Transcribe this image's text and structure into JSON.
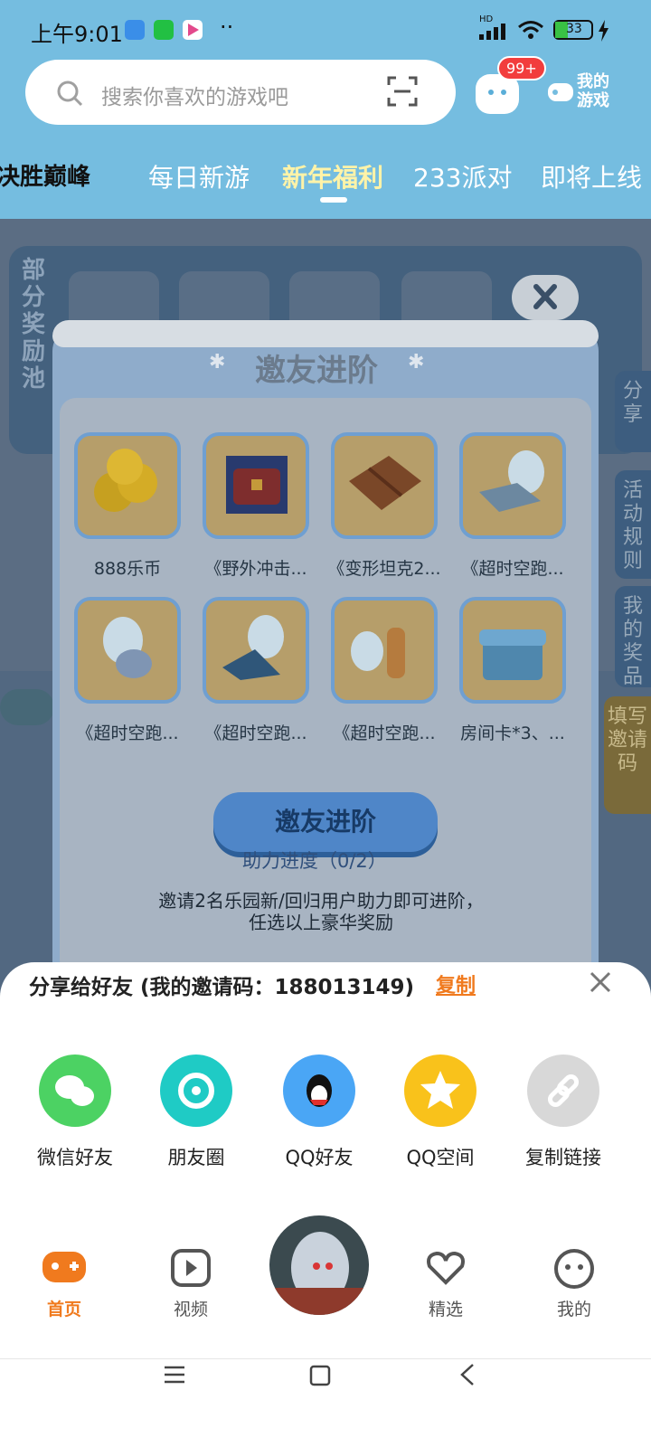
{
  "status_bar": {
    "time": "上午9:01",
    "dots": "··",
    "network": "HD",
    "battery": "33"
  },
  "search": {
    "placeholder": "搜索你喜欢的游戏吧",
    "message_badge": "99+",
    "my_games": "我的\n游戏"
  },
  "tabs": [
    {
      "label": "决胜巅峰"
    },
    {
      "label": "每日新游"
    },
    {
      "label": "新年福利",
      "active": true
    },
    {
      "label": "233派对"
    },
    {
      "label": "即将上线"
    }
  ],
  "background": {
    "reward_pool": "部分奖励池"
  },
  "side_tabs": [
    "分享",
    "活动规则",
    "我的奖品",
    "填写邀请码"
  ],
  "modal": {
    "title": "邀友进阶",
    "rewards": [
      {
        "label": "888乐币"
      },
      {
        "label": "《野外冲击..."
      },
      {
        "label": "《变形坦克2..."
      },
      {
        "label": "《超时空跑..."
      },
      {
        "label": "《超时空跑..."
      },
      {
        "label": "《超时空跑..."
      },
      {
        "label": "《超时空跑..."
      },
      {
        "label": "房间卡*3、..."
      }
    ],
    "button_label": "邀友进阶",
    "progress": "助力进度（0/2）",
    "description_line1": "邀请2名乐园新/回归用户助力即可进阶，",
    "description_line2": "任选以上豪华奖励"
  },
  "share_sheet": {
    "title": "分享给好友 (我的邀请码：188013149)",
    "copy_link_text": "复制",
    "items": [
      {
        "label": "微信好友",
        "icon": "wechat-icon",
        "color": "#4cd263"
      },
      {
        "label": "朋友圈",
        "icon": "moments-icon",
        "color": "#1fcbc5"
      },
      {
        "label": "QQ好友",
        "icon": "qq-icon",
        "color": "#4aa6f5"
      },
      {
        "label": "QQ空间",
        "icon": "qzone-icon",
        "color": "#f9c21b"
      },
      {
        "label": "复制链接",
        "icon": "link-icon",
        "color": "#d8d8d8"
      }
    ]
  },
  "bottom_nav": [
    {
      "label": "首页",
      "active": true,
      "icon": "gamepad-icon"
    },
    {
      "label": "视频",
      "icon": "play-icon"
    },
    {
      "label": "",
      "icon": "avatar"
    },
    {
      "label": "精选",
      "icon": "heart-icon"
    },
    {
      "label": "我的",
      "icon": "face-icon"
    }
  ],
  "colors": {
    "header": "#75bde0",
    "accent": "#f07a1e",
    "active_tab": "#fff3a8"
  }
}
